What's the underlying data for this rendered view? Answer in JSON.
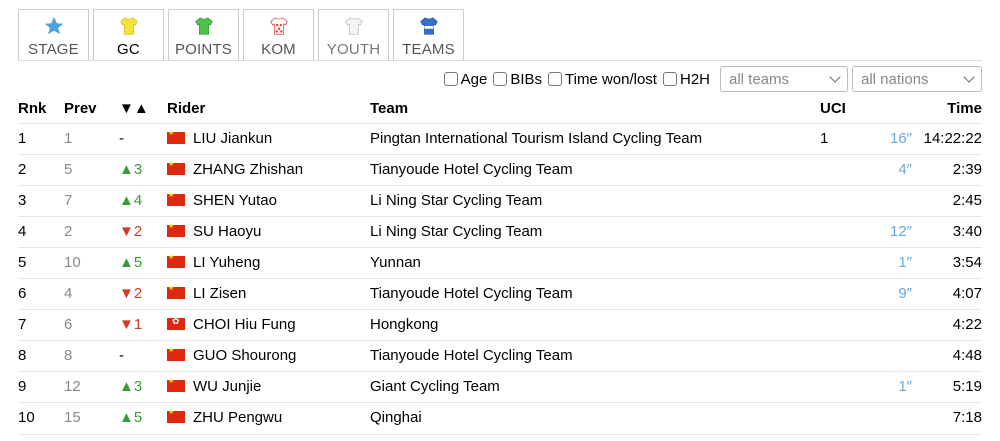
{
  "tabs": [
    {
      "label": "STAGE",
      "icon": "star-icon",
      "color": "#4aa3df"
    },
    {
      "label": "GC",
      "icon": "yellow-jersey-icon",
      "color": "#f5e13a",
      "active": true
    },
    {
      "label": "POINTS",
      "icon": "green-jersey-icon",
      "color": "#4cc24c"
    },
    {
      "label": "KOM",
      "icon": "polka-dot-jersey-icon",
      "color": "#e04040"
    },
    {
      "label": "YOUTH",
      "icon": "white-jersey-icon",
      "color": "#eeeeee"
    },
    {
      "label": "TEAMS",
      "icon": "team-jersey-icon",
      "color": "#3a6fc9"
    }
  ],
  "filters": {
    "age": "Age",
    "bibs": "BIBs",
    "time_won_lost": "Time won/lost",
    "h2h": "H2H",
    "teams_select": "all teams",
    "nations_select": "all nations"
  },
  "table": {
    "headers": {
      "rnk": "Rnk",
      "prev": "Prev",
      "diff": "▼▲",
      "rider": "Rider",
      "team": "Team",
      "uci": "UCI",
      "time": "Time"
    },
    "rows": [
      {
        "rnk": "1",
        "prev": "1",
        "diff": "-",
        "dir": "none",
        "flag": "cn",
        "rider": "LIU Jiankun",
        "team": "Pingtan International Tourism Island Cycling Team",
        "uci": "1",
        "bonus": "16″",
        "time": "14:22:22"
      },
      {
        "rnk": "2",
        "prev": "5",
        "diff": "▲3",
        "dir": "up",
        "flag": "cn",
        "rider": "ZHANG Zhishan",
        "team": "Tianyoude Hotel Cycling Team",
        "uci": "",
        "bonus": "4″",
        "time": "2:39"
      },
      {
        "rnk": "3",
        "prev": "7",
        "diff": "▲4",
        "dir": "up",
        "flag": "cn",
        "rider": "SHEN Yutao",
        "team": "Li Ning Star Cycling Team",
        "uci": "",
        "bonus": "",
        "time": "2:45"
      },
      {
        "rnk": "4",
        "prev": "2",
        "diff": "▼2",
        "dir": "down",
        "flag": "cn",
        "rider": "SU Haoyu",
        "team": "Li Ning Star Cycling Team",
        "uci": "",
        "bonus": "12″",
        "time": "3:40"
      },
      {
        "rnk": "5",
        "prev": "10",
        "diff": "▲5",
        "dir": "up",
        "flag": "cn",
        "rider": "LI Yuheng",
        "team": "Yunnan",
        "uci": "",
        "bonus": "1″",
        "time": "3:54"
      },
      {
        "rnk": "6",
        "prev": "4",
        "diff": "▼2",
        "dir": "down",
        "flag": "cn",
        "rider": "LI Zisen",
        "team": "Tianyoude Hotel Cycling Team",
        "uci": "",
        "bonus": "9″",
        "time": "4:07"
      },
      {
        "rnk": "7",
        "prev": "6",
        "diff": "▼1",
        "dir": "down",
        "flag": "hk",
        "rider": "CHOI Hiu Fung",
        "team": "Hongkong",
        "uci": "",
        "bonus": "",
        "time": "4:22"
      },
      {
        "rnk": "8",
        "prev": "8",
        "diff": "-",
        "dir": "none",
        "flag": "cn",
        "rider": "GUO Shourong",
        "team": "Tianyoude Hotel Cycling Team",
        "uci": "",
        "bonus": "",
        "time": "4:48"
      },
      {
        "rnk": "9",
        "prev": "12",
        "diff": "▲3",
        "dir": "up",
        "flag": "cn",
        "rider": "WU Junjie",
        "team": "Giant Cycling Team",
        "uci": "",
        "bonus": "1″",
        "time": "5:19"
      },
      {
        "rnk": "10",
        "prev": "15",
        "diff": "▲5",
        "dir": "up",
        "flag": "cn",
        "rider": "ZHU Pengwu",
        "team": "Qinghai",
        "uci": "",
        "bonus": "",
        "time": "7:18"
      }
    ]
  }
}
